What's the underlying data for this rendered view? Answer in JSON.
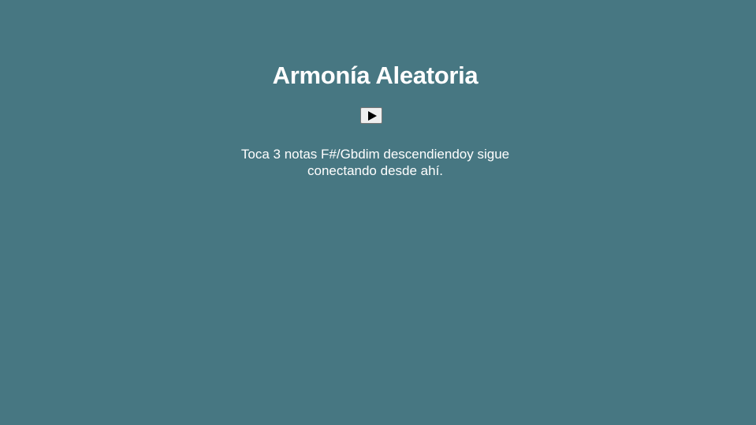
{
  "header": {
    "title": "Armonía Aleatoria"
  },
  "controls": {
    "play_icon": "play-icon"
  },
  "main": {
    "instructions": "Toca 3 notas F#/Gbdim descendiendoy sigue conectando desde ahí."
  },
  "colors": {
    "background": "#477782",
    "text": "#ffffff",
    "button_background": "#efefef"
  }
}
